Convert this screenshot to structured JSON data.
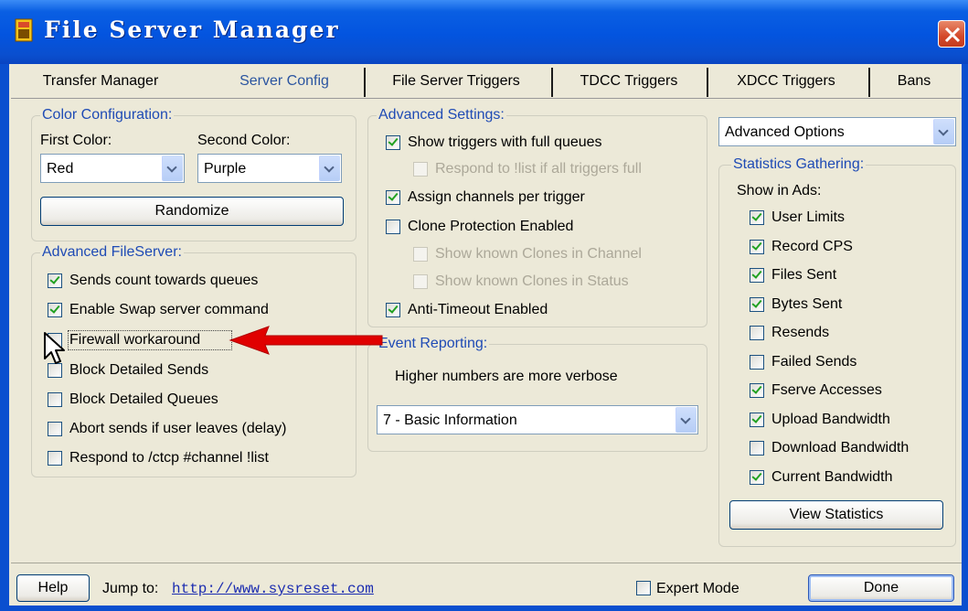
{
  "window": {
    "title": "File Server Manager"
  },
  "tabs": [
    {
      "label": "Transfer Manager",
      "active": false
    },
    {
      "label": "Server Config",
      "active": true
    },
    {
      "label": "File Server Triggers",
      "active": false
    },
    {
      "label": "TDCC Triggers",
      "active": false
    },
    {
      "label": "XDCC Triggers",
      "active": false
    },
    {
      "label": "Bans",
      "active": false
    }
  ],
  "color_config": {
    "title": "Color Configuration:",
    "first_label": "First Color:",
    "second_label": "Second Color:",
    "first_value": "Red",
    "second_value": "Purple",
    "randomize_label": "Randomize"
  },
  "adv_fileserver": {
    "title": "Advanced FileServer:",
    "items": [
      {
        "label": "Sends count towards queues",
        "checked": true
      },
      {
        "label": "Enable Swap server command",
        "checked": true
      },
      {
        "label": "Firewall workaround",
        "checked": false
      },
      {
        "label": "Block Detailed Sends",
        "checked": false
      },
      {
        "label": "Block Detailed Queues",
        "checked": false
      },
      {
        "label": "Abort sends if user leaves (delay)",
        "checked": false
      },
      {
        "label": "Respond to /ctcp #channel !list",
        "checked": false
      }
    ]
  },
  "adv_settings": {
    "title": "Advanced Settings:",
    "items": [
      {
        "label": "Show triggers with full queues",
        "checked": true,
        "disabled": false
      },
      {
        "label": "Respond to !list if all triggers full",
        "checked": false,
        "disabled": true
      },
      {
        "label": "Assign channels per trigger",
        "checked": true,
        "disabled": false
      },
      {
        "label": "Clone Protection Enabled",
        "checked": false,
        "disabled": false
      },
      {
        "label": "Show known Clones in Channel",
        "checked": false,
        "disabled": true
      },
      {
        "label": "Show known Clones in Status",
        "checked": false,
        "disabled": true
      },
      {
        "label": "Anti-Timeout Enabled",
        "checked": true,
        "disabled": false
      }
    ]
  },
  "event_reporting": {
    "title": "Event Reporting:",
    "hint": "Higher numbers are more verbose",
    "level_value": "7 - Basic Information"
  },
  "options_select": {
    "value": "Advanced Options"
  },
  "stats": {
    "title": "Statistics Gathering:",
    "show_in_ads": "Show in Ads:",
    "items": [
      {
        "label": "User Limits",
        "checked": true
      },
      {
        "label": "Record CPS",
        "checked": true
      },
      {
        "label": "Files Sent",
        "checked": true
      },
      {
        "label": "Bytes Sent",
        "checked": true
      },
      {
        "label": "Resends",
        "checked": false
      },
      {
        "label": "Failed Sends",
        "checked": false
      },
      {
        "label": "Fserve Accesses",
        "checked": true
      },
      {
        "label": "Upload Bandwidth",
        "checked": true
      },
      {
        "label": "Download Bandwidth",
        "checked": false
      },
      {
        "label": "Current Bandwidth",
        "checked": true
      }
    ],
    "view_label": "View Statistics"
  },
  "footer": {
    "help_label": "Help",
    "jump_label": "Jump to:",
    "link": "http://www.sysreset.com",
    "expert_label": "Expert Mode",
    "expert_checked": false,
    "done_label": "Done"
  },
  "colors": {
    "title_bar": "#0354df",
    "group_title": "#1f4bb5",
    "arrow": "#e00000",
    "window_bg": "#ece9d8"
  }
}
